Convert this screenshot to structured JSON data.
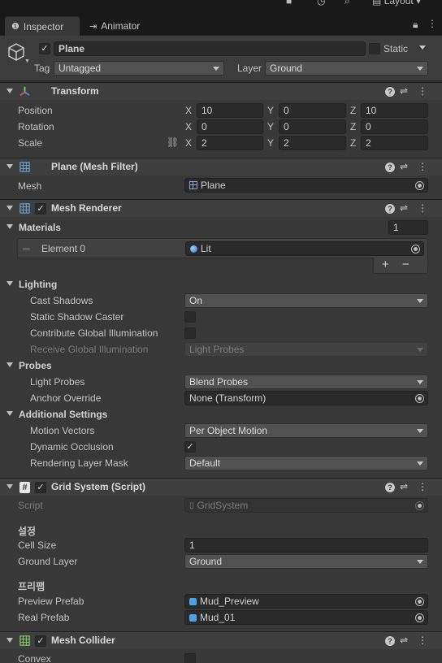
{
  "tabs": [
    {
      "label": "Inspector",
      "icon": "info-icon"
    },
    {
      "label": "Animator",
      "icon": "animator-icon"
    }
  ],
  "topbar": {
    "layout_label": "Layout"
  },
  "gameobject": {
    "name": "Plane",
    "active": true,
    "static_label": "Static",
    "tag_label": "Tag",
    "tag_value": "Untagged",
    "layer_label": "Layer",
    "layer_value": "Ground"
  },
  "transform": {
    "title": "Transform",
    "rows": [
      {
        "label": "Position",
        "x": "10",
        "y": "0",
        "z": "10"
      },
      {
        "label": "Rotation",
        "x": "0",
        "y": "0",
        "z": "0"
      },
      {
        "label": "Scale",
        "x": "2",
        "y": "2",
        "z": "2"
      }
    ],
    "axis": {
      "x": "X",
      "y": "Y",
      "z": "Z"
    }
  },
  "mesh_filter": {
    "title": "Plane (Mesh Filter)",
    "mesh_label": "Mesh",
    "mesh_value": "Plane"
  },
  "mesh_renderer": {
    "title": "Mesh Renderer",
    "enabled": true,
    "materials_label": "Materials",
    "materials_count": "1",
    "element_label": "Element 0",
    "element_value": "Lit",
    "add": "+",
    "remove": "−",
    "lighting_label": "Lighting",
    "cast_shadows_label": "Cast Shadows",
    "cast_shadows_value": "On",
    "static_shadow_label": "Static Shadow Caster",
    "contribute_gi_label": "Contribute Global Illumination",
    "receive_gi_label": "Receive Global Illumination",
    "receive_gi_value": "Light Probes",
    "probes_label": "Probes",
    "light_probes_label": "Light Probes",
    "light_probes_value": "Blend Probes",
    "anchor_label": "Anchor Override",
    "anchor_value": "None (Transform)",
    "additional_label": "Additional Settings",
    "motion_label": "Motion Vectors",
    "motion_value": "Per Object Motion",
    "occlusion_label": "Dynamic Occlusion",
    "rendering_mask_label": "Rendering Layer Mask",
    "rendering_mask_value": "Default"
  },
  "grid_system": {
    "title": "Grid System (Script)",
    "enabled": true,
    "script_label": "Script",
    "script_value": "GridSystem",
    "settings_header": "설정",
    "cell_size_label": "Cell Size",
    "cell_size_value": "1",
    "ground_layer_label": "Ground Layer",
    "ground_layer_value": "Ground",
    "prefab_header": "프리팹",
    "preview_label": "Preview Prefab",
    "preview_value": "Mud_Preview",
    "real_label": "Real Prefab",
    "real_value": "Mud_01"
  },
  "mesh_collider": {
    "title": "Mesh Collider",
    "enabled": true,
    "convex_label": "Convex"
  },
  "colors": {
    "background": "#383838",
    "field": "#2a2a2a",
    "dropdown": "#515151",
    "header": "#3e3e3e",
    "prefab_blue": "#4aa3e8"
  }
}
